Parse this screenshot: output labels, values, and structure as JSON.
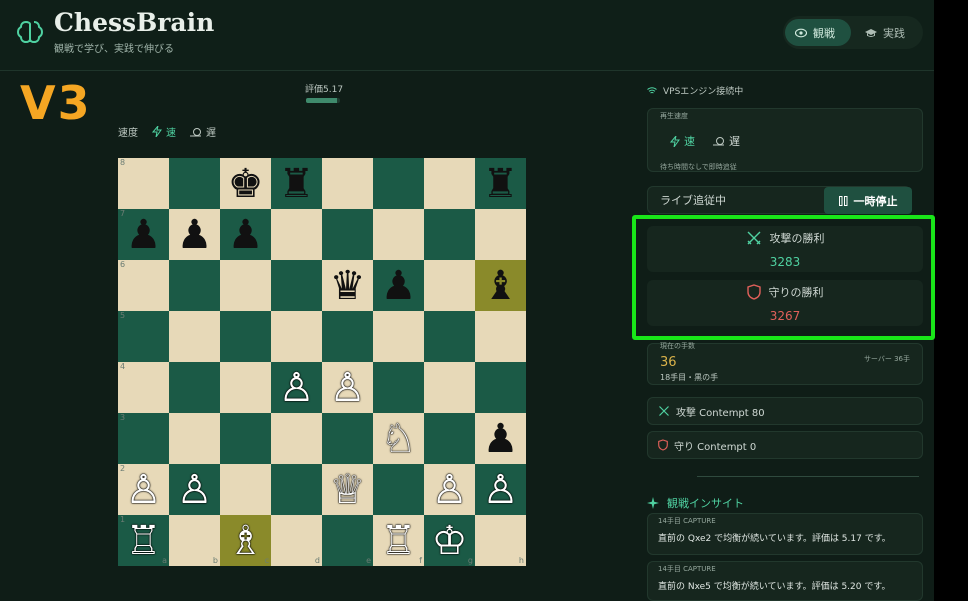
{
  "header": {
    "title": "ChessBrain",
    "subtitle": "観戦で学び、実践で伸びる",
    "modes": {
      "watch": "観戦",
      "play": "実践"
    }
  },
  "overlay": {
    "version_label": "V3"
  },
  "evaluation": {
    "label": "評価",
    "value": "5.17",
    "fill_fraction": 0.9
  },
  "speed": {
    "label": "速度",
    "fast": "速",
    "slow": "遅"
  },
  "board": {
    "ranks": [
      "8",
      "7",
      "6",
      "5",
      "4",
      "3",
      "2",
      "1"
    ],
    "files": [
      "a",
      "b",
      "c",
      "d",
      "e",
      "f",
      "g",
      "h"
    ],
    "position": [
      [
        "",
        "",
        "♚",
        "♜",
        "",
        "",
        "",
        "♜"
      ],
      [
        "♟",
        "♟",
        "♟",
        "",
        "",
        "",
        "",
        ""
      ],
      [
        "",
        "",
        "",
        "",
        "♛",
        "♟",
        "",
        "♝"
      ],
      [
        "",
        "",
        "",
        "",
        "",
        "",
        "",
        ""
      ],
      [
        "",
        "",
        "",
        "♙",
        "♙",
        "",
        "",
        ""
      ],
      [
        "",
        "",
        "",
        "",
        "",
        "♘",
        "",
        "♟"
      ],
      [
        "♙",
        "♙",
        "",
        "",
        "♕",
        "",
        "♙",
        "♙"
      ],
      [
        "♖",
        "",
        "♗",
        "",
        "",
        "♖",
        "♔",
        ""
      ]
    ],
    "white_pieces": [
      "♔",
      "♕",
      "♖",
      "♗",
      "♘",
      "♙"
    ],
    "highlights": [
      "h6",
      "c1"
    ]
  },
  "sidebar": {
    "vps_status": "VPSエンジン接続中",
    "playback": {
      "title": "再生速度",
      "fast": "速",
      "slow": "遅",
      "note": "待ち時間なしで即時追従"
    },
    "live": {
      "status": "ライブ追従中",
      "pause": "一時停止"
    },
    "stats": {
      "attack_label": "攻撃の勝利",
      "attack_value": "3283",
      "defense_label": "守りの勝利",
      "defense_value": "3267"
    },
    "moves": {
      "label": "現在の手数",
      "value": "36",
      "detail": "18手目・黒の手",
      "server": "サーバー 36手"
    },
    "engines": {
      "attack": "攻撃  Contempt 80",
      "defense": "守り  Contempt 0"
    },
    "insights": {
      "title": "観戦インサイト",
      "items": [
        {
          "head": "14手目  CAPTURE",
          "text": "直前の Qxe2 で均衡が続いています。評価は 5.17 です。"
        },
        {
          "head": "14手目  CAPTURE",
          "text": "直前の Nxe5 で均衡が続いています。評価は 5.20 です。"
        }
      ]
    }
  },
  "colors": {
    "accent": "#4fd1a1",
    "attack_value": "#4fd1a1",
    "defense_value": "#e0605a",
    "highlight_frame": "#19e619",
    "version_label": "#f5a623"
  }
}
